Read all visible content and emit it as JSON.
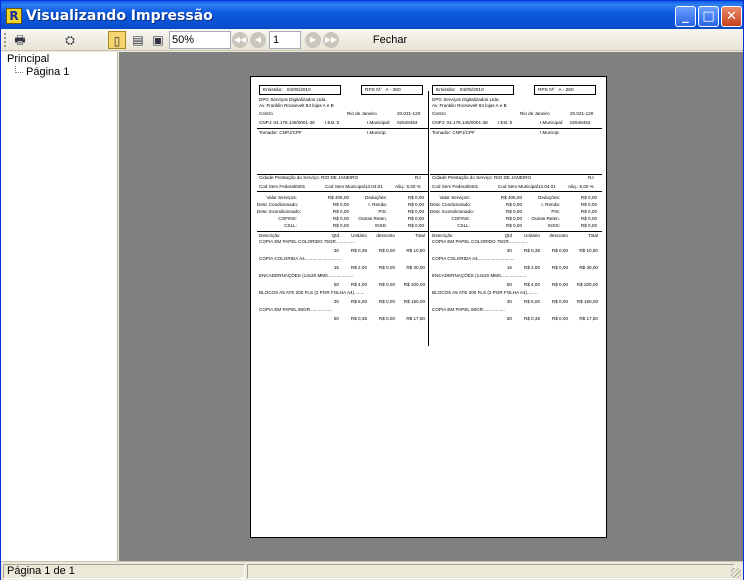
{
  "window": {
    "title": "Visualizando Impressão",
    "app_icon_letter": "R",
    "minimize_glyph": "_",
    "maximize_glyph": "□",
    "close_glyph": "✕"
  },
  "toolbar": {
    "zoom_value": "50%",
    "page_value": "1",
    "close_label": "Fechar",
    "icons": {
      "print": "🖶",
      "find": "⛭",
      "single_page": "▯",
      "page_width": "▤",
      "full_page": "▣",
      "first": "◀◀",
      "prev": "◀",
      "next": "▶",
      "last": "▶▶"
    }
  },
  "sidebar": {
    "root_label": "Principal",
    "child_label": "Página 1"
  },
  "statusbar": {
    "page_info": "Página 1 de 1"
  },
  "receipt": {
    "emissao_label": "Emissão:",
    "emissao_value": "04/05/2010",
    "rps_label": "RPS Nº",
    "rps_value": "A - 260",
    "company": "DPG Serviços Digitalizados Ltda.",
    "address": "Av. Franklin Roosevelt 84 lojas A e B",
    "bairro": "Centro",
    "cidade": "Rio de Janeiro",
    "cep": "20.021-120",
    "cnpj": "CNPJ: 04.178.145/0001-38",
    "iest": "I.Est.:0",
    "imun_label": "I.Municipal:",
    "imun_value": "02546453",
    "tomador": "Tomador: CNPJ/CPF",
    "tomador_imun": "I.Municip:",
    "cidade_prestacao": "Cidade Prestação do Serviço: RIO DE JANEIRO",
    "uf": "RJ",
    "cod_federal": "Cod Serv Federal0401",
    "cod_municipal": "Cod Serv Municipal13.04.01",
    "aliq": "Aliq.: 5,00 %",
    "taxes": [
      [
        "Valor Serviços:",
        "R$ 405,00",
        "Deduções:",
        "R$ 0,00"
      ],
      [
        "Desc Condicionado:",
        "R$ 0,00",
        "I. Renda:",
        "R$ 0,00"
      ],
      [
        "Desc Incondicionado:",
        "R$ 0,00",
        "PIS:",
        "R$ 0,00"
      ],
      [
        "COFINS:",
        "R$ 0,00",
        "Outras Reten.",
        "R$ 0,00"
      ],
      [
        "CSLL:",
        "R$ 0,00",
        "INSS:",
        "R$ 0,00"
      ]
    ],
    "items_header": [
      "Descrição",
      "Qtd",
      "Unitário",
      "desconto",
      "Total"
    ],
    "items": [
      {
        "desc": "COPIA EM PAPEL COLORIDO 75GR...............",
        "qtd": "30",
        "unit": "R$ 0,35",
        "disc": "R$ 0,00",
        "total": "R$ 10,50"
      },
      {
        "desc": "COPIA COLORIDA A4.............................",
        "qtd": "15",
        "unit": "R$ 2,00",
        "disc": "R$ 0,00",
        "total": "R$ 30,00"
      },
      {
        "desc": "ENCADERNAÇÕES (14x20 MM0....................",
        "qtd": "50",
        "unit": "R$ 4,00",
        "disc": "R$ 0,00",
        "total": "R$ 200,00"
      },
      {
        "desc": "BLOCOS A5 ATE 200 FLS (2 POR FOLHA A4)........",
        "qtd": "30",
        "unit": "R$ 5,00",
        "disc": "R$ 0,00",
        "total": "R$ 150,00"
      },
      {
        "desc": "COPIA EM PAPEL 90GR.................",
        "qtd": "50",
        "unit": "R$ 0,35",
        "disc": "R$ 0,00",
        "total": "R$ 17,50"
      }
    ]
  }
}
